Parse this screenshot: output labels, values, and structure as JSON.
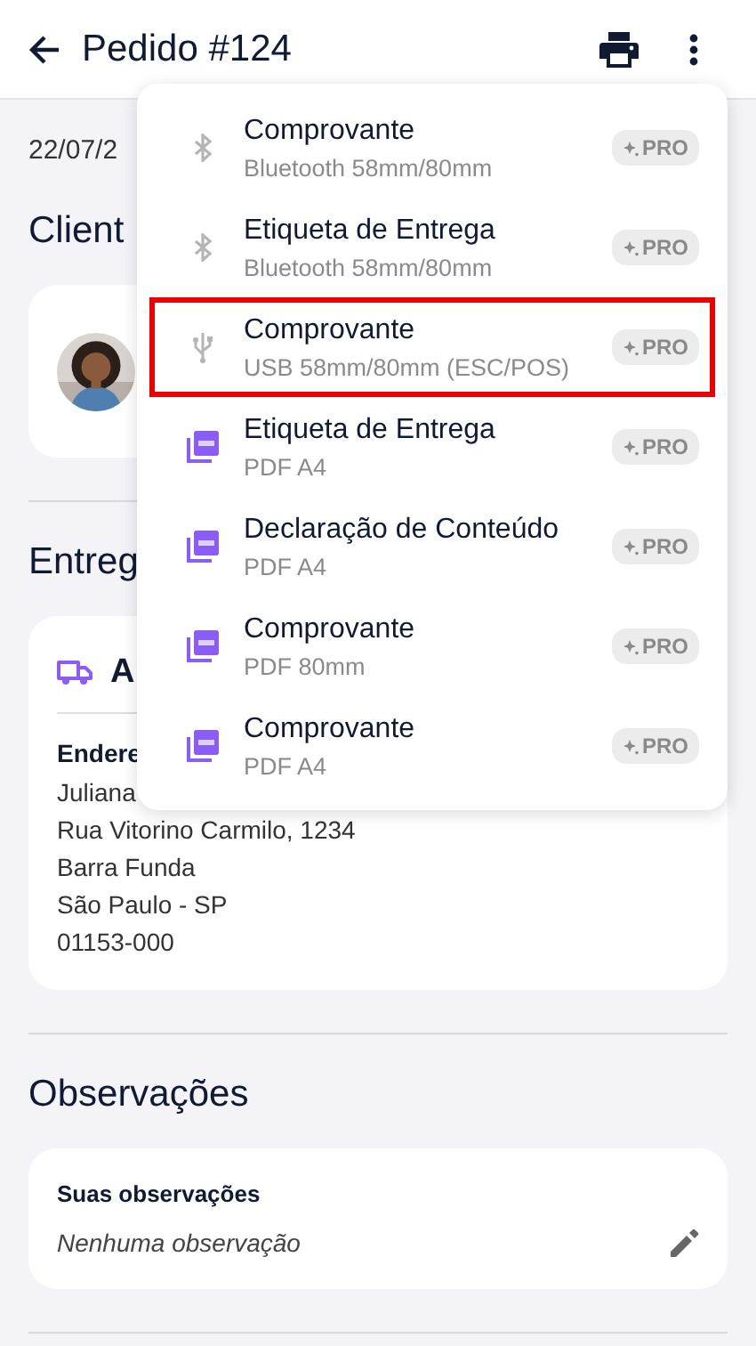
{
  "header": {
    "title": "Pedido #124"
  },
  "date": "22/07/2",
  "client": {
    "heading": "Client"
  },
  "delivery": {
    "heading": "Entreg",
    "card": {
      "title": "A",
      "address_label": "Endere",
      "lines": [
        "Juliana",
        "Rua Vitorino Carmilo, 1234",
        "Barra Funda",
        "São Paulo - SP",
        "01153-000"
      ]
    }
  },
  "observations": {
    "heading": "Observações",
    "label": "Suas observações",
    "value": "Nenhuma observação"
  },
  "print_menu": [
    {
      "title": "Comprovante",
      "subtitle": "Bluetooth 58mm/80mm",
      "kind": "bluetooth",
      "selected": false,
      "badge": "PRO"
    },
    {
      "title": "Etiqueta de Entrega",
      "subtitle": "Bluetooth 58mm/80mm",
      "kind": "bluetooth",
      "selected": false,
      "badge": "PRO"
    },
    {
      "title": "Comprovante",
      "subtitle": "USB 58mm/80mm (ESC/POS)",
      "kind": "usb",
      "selected": true,
      "badge": "PRO"
    },
    {
      "title": "Etiqueta de Entrega",
      "subtitle": "PDF A4",
      "kind": "pdf",
      "selected": false,
      "badge": "PRO"
    },
    {
      "title": "Declaração de Conteúdo",
      "subtitle": "PDF A4",
      "kind": "pdf",
      "selected": false,
      "badge": "PRO"
    },
    {
      "title": "Comprovante",
      "subtitle": "PDF 80mm",
      "kind": "pdf",
      "selected": false,
      "badge": "PRO"
    },
    {
      "title": "Comprovante",
      "subtitle": "PDF A4",
      "kind": "pdf",
      "selected": false,
      "badge": "PRO"
    }
  ]
}
